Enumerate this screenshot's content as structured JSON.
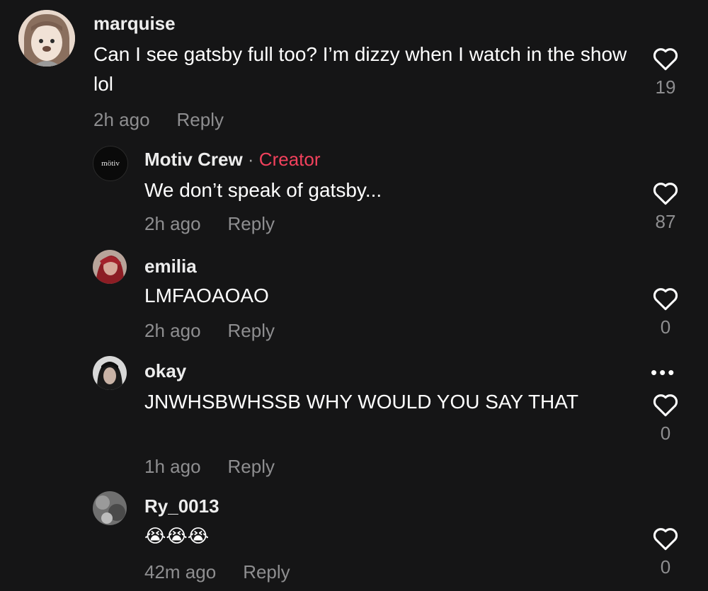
{
  "comments": [
    {
      "username": "marquise",
      "text": "Can I see gatsby full too? I’m dizzy when I watch in the show lol",
      "time": "2h ago",
      "reply": "Reply",
      "likes": "19"
    },
    {
      "username": "Motiv Crew",
      "separator": " · ",
      "creator_label": "Creator",
      "avatar_text": "mötiv",
      "text": "We don’t speak of gatsby...",
      "time": "2h ago",
      "reply": "Reply",
      "likes": "87"
    },
    {
      "username": "emilia",
      "text": "LMFAOAOAO",
      "time": "2h ago",
      "reply": "Reply",
      "likes": "0"
    },
    {
      "username": "okay",
      "text": "JNWHSBWHSSB WHY WOULD YOU SAY THAT",
      "time": "1h ago",
      "reply": "Reply",
      "likes": "0",
      "more": "•••"
    },
    {
      "username": "Ry_0013",
      "text": "😭😭😭",
      "time": "42m ago",
      "reply": "Reply",
      "likes": "0"
    }
  ],
  "icons": {
    "like": "heart-outline-icon",
    "more": "more-options-icon"
  },
  "colors": {
    "background": "#151516",
    "creator": "#f1415c",
    "meta": "#8e8e90"
  }
}
